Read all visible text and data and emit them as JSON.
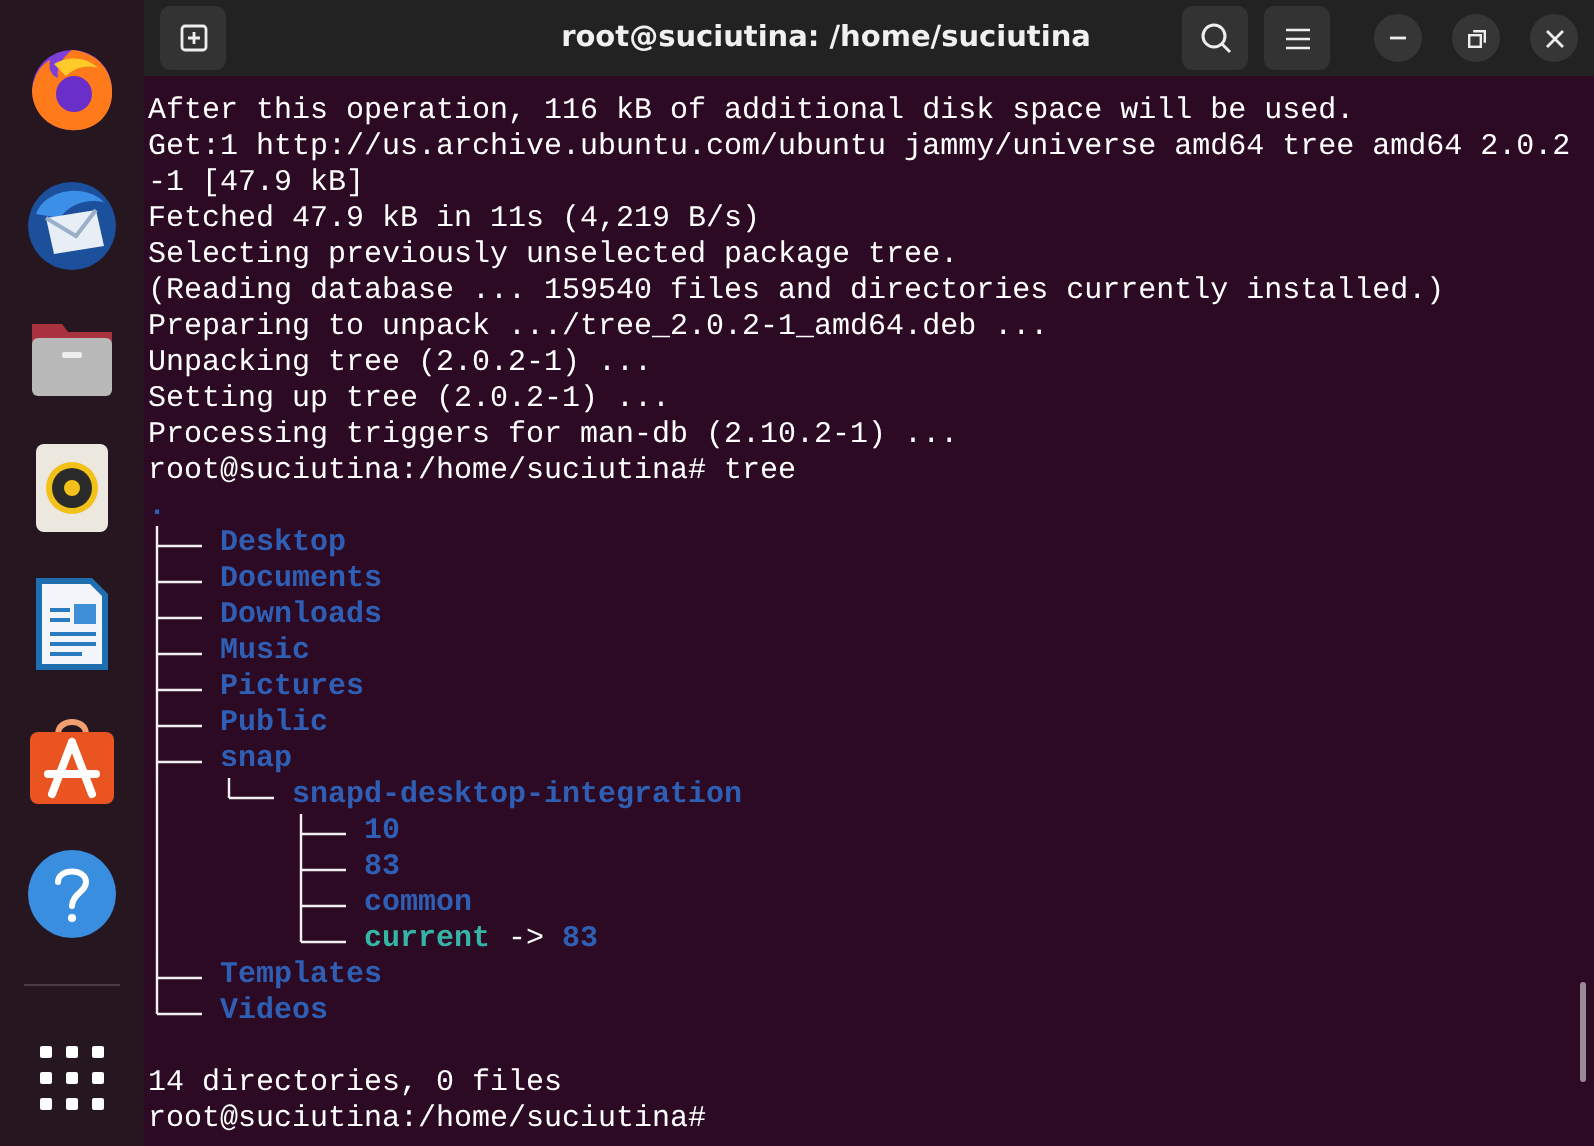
{
  "window": {
    "title": "root@suciutina: /home/suciutina"
  },
  "terminal": {
    "output_lines": [
      "After this operation, 116 kB of additional disk space will be used.",
      "Get:1 http://us.archive.ubuntu.com/ubuntu jammy/universe amd64 tree amd64 2.0.2",
      "-1 [47.9 kB]",
      "Fetched 47.9 kB in 11s (4,219 B/s)",
      "Selecting previously unselected package tree.",
      "(Reading database ... 159540 files and directories currently installed.)",
      "Preparing to unpack .../tree_2.0.2-1_amd64.deb ...",
      "Unpacking tree (2.0.2-1) ...",
      "Setting up tree (2.0.2-1) ...",
      "Processing triggers for man-db (2.10.2-1) ..."
    ],
    "command_line": {
      "prompt": "root@suciutina:/home/suciutina#",
      "command": "tree"
    },
    "tree": {
      "root": ".",
      "children": [
        {
          "name": "Desktop",
          "kind": "dir"
        },
        {
          "name": "Documents",
          "kind": "dir"
        },
        {
          "name": "Downloads",
          "kind": "dir"
        },
        {
          "name": "Music",
          "kind": "dir"
        },
        {
          "name": "Pictures",
          "kind": "dir"
        },
        {
          "name": "Public",
          "kind": "dir"
        },
        {
          "name": "snap",
          "kind": "dir",
          "children": [
            {
              "name": "snapd-desktop-integration",
              "kind": "dir",
              "children": [
                {
                  "name": "10",
                  "kind": "dir"
                },
                {
                  "name": "83",
                  "kind": "dir"
                },
                {
                  "name": "common",
                  "kind": "dir"
                },
                {
                  "name": "current",
                  "kind": "symlink",
                  "arrow": "->",
                  "target": "83"
                }
              ]
            }
          ]
        },
        {
          "name": "Templates",
          "kind": "dir"
        },
        {
          "name": "Videos",
          "kind": "dir"
        }
      ]
    },
    "summary": "14 directories, 0 files",
    "final_prompt": "root@suciutina:/home/suciutina#"
  }
}
